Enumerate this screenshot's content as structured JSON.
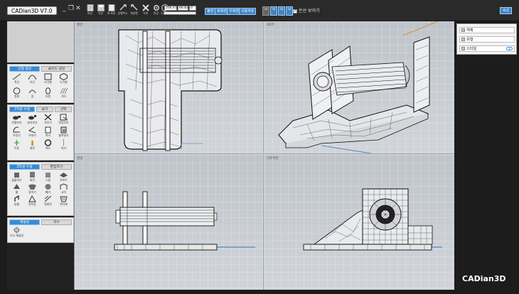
{
  "app": {
    "title": "CADian3D V7.0",
    "brand": "CADian3D"
  },
  "window_controls": {
    "minimize": "_",
    "restore": "❐",
    "close": "✕"
  },
  "toolbar": {
    "tools": [
      {
        "label": "파일",
        "icon": "file-icon"
      },
      {
        "label": "저장",
        "icon": "save-icon"
      },
      {
        "label": "새 파일",
        "icon": "new-file-icon"
      },
      {
        "label": "실행취소",
        "icon": "undo-icon"
      },
      {
        "label": "재실행",
        "icon": "redo-icon"
      },
      {
        "label": "삭제",
        "icon": "delete-icon"
      },
      {
        "label": "환경",
        "icon": "settings-icon"
      },
      {
        "label": "도움말",
        "icon": "help-icon"
      }
    ],
    "coords": [
      "200.47",
      "66.83",
      "0"
    ],
    "views": [
      "평면",
      "좌측면",
      "우측면",
      "사용자뷰"
    ],
    "small_buttons": [
      "2D",
      "3D",
      "3D",
      "3D"
    ],
    "hide_lines_label": "은선 보이기",
    "properties_label": "속성"
  },
  "left_panel": {
    "sections": [
      {
        "tabs": [
          "선형 생성",
          "솔리드 생성"
        ],
        "items": [
          "직선",
          "호선",
          "사각형",
          "다각형",
          "원형",
          "점",
          "타원",
          "가타"
        ]
      },
      {
        "tabs": [
          "2차원 수정",
          "보기",
          "선택"
        ],
        "items": [
          "연결하기",
          "분리하기",
          "자르기",
          "연장하기",
          "모깎기",
          "모따기",
          "복사",
          "붙여넣기",
          "이동",
          "회전",
          "척도",
          "미러"
        ]
      },
      {
        "tabs": [
          "3차원 수정",
          "편집하기"
        ],
        "items": [
          "돌출하기",
          "회전",
          "스윕",
          "로프트",
          "쉘",
          "합치기",
          "빼기",
          "교차",
          "분할",
          "면이동",
          "면회전",
          "면삭제"
        ]
      },
      {
        "tabs": [
          "재생성",
          "치수"
        ],
        "items": [
          "다시 재생성"
        ]
      }
    ]
  },
  "viewports": [
    {
      "label": "평면"
    },
    {
      "label": "3D뷰"
    },
    {
      "label": "정면"
    },
    {
      "label": "오른쪽면"
    }
  ],
  "right_panel": {
    "items": [
      "객체",
      "유형",
      "스타일"
    ]
  }
}
